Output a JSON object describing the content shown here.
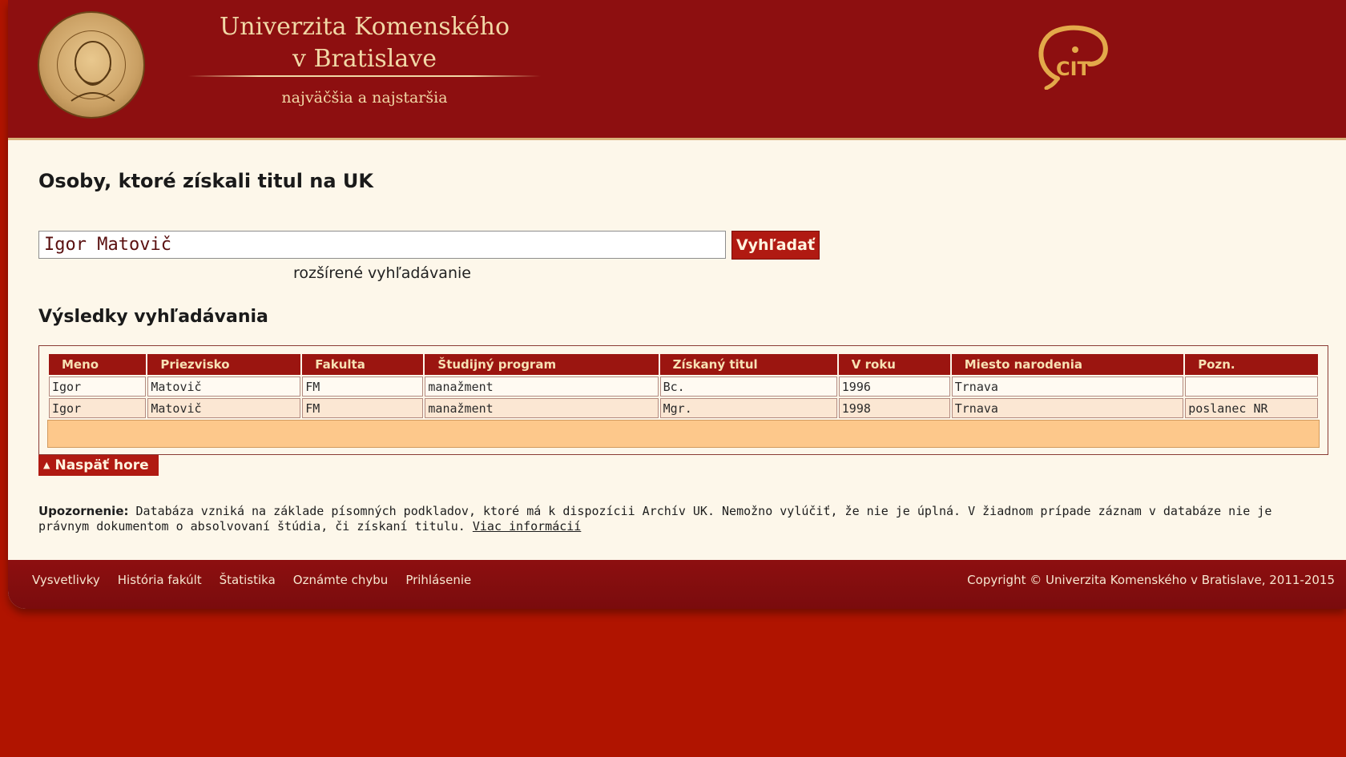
{
  "header": {
    "university_line1": "Univerzita Komenského",
    "university_line2": "v Bratislave",
    "university_tagline": "najväčšia a najstaršia",
    "seal_icon": "university-seal-icon",
    "cit_logo_text": "CIT"
  },
  "main": {
    "page_title": "Osoby, ktoré získali titul na UK",
    "search": {
      "value": "Igor Matovič",
      "button_label": "Vyhľadať",
      "advanced_link": "rozšírené vyhľadávanie"
    },
    "results_title": "Výsledky vyhľadávania",
    "table": {
      "columns": [
        "Meno",
        "Priezvisko",
        "Fakulta",
        "Študijný program",
        "Získaný titul",
        "V roku",
        "Miesto narodenia",
        "Pozn."
      ],
      "rows": [
        [
          "Igor",
          "Matovič",
          "FM",
          "manažment",
          "Bc.",
          "1996",
          "Trnava",
          ""
        ],
        [
          "Igor",
          "Matovič",
          "FM",
          "manažment",
          "Mgr.",
          "1998",
          "Trnava",
          "poslanec NR"
        ]
      ]
    },
    "back_to_top": "Naspäť hore",
    "notice": {
      "label": "Upozornenie:",
      "text": " Databáza vzniká na základe písomných podkladov, ktoré má k dispozícii Archív UK. Nemožno vylúčiť, že nie je úplná. V žiadnom prípade záznam v databáze nie je právnym dokumentom o absolvovaní štúdia, či získaní titulu. ",
      "link": "Viac informácií"
    }
  },
  "footer": {
    "nav": [
      "Vysvetlivky",
      "História fakúlt",
      "Štatistika",
      "Oznámte chybu",
      "Prihlásenie"
    ],
    "copyright": "Copyright © Univerzita Komenského v Bratislave, 2011-2015"
  },
  "colors": {
    "header_bg": "#8d0f10",
    "body_bg": "#b01400",
    "accent_button": "#b01a12",
    "page_bg": "#fdf7ea",
    "results_bar": "#fdc88b"
  }
}
